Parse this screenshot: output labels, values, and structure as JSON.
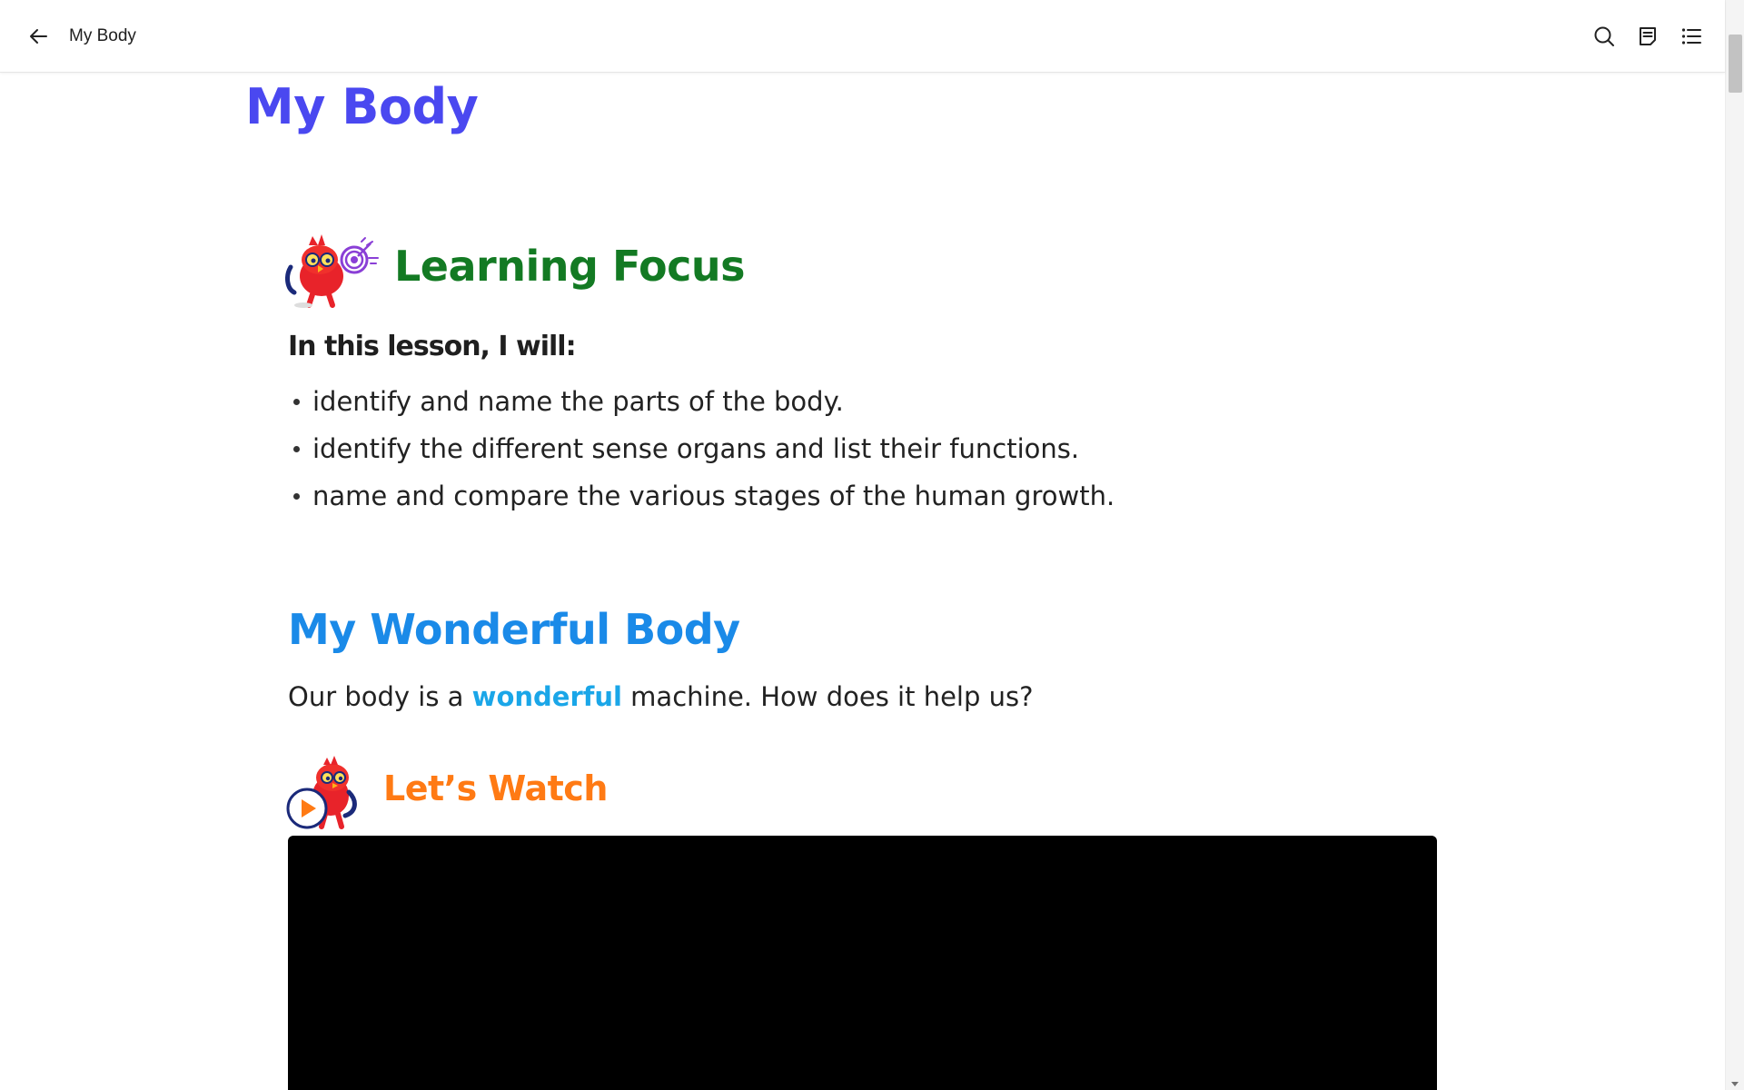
{
  "topbar": {
    "title": "My Body",
    "back_icon": "arrow-left-icon",
    "tools": [
      "search-icon",
      "notes-icon",
      "list-icon"
    ]
  },
  "page": {
    "title": "My Body"
  },
  "learning_focus": {
    "heading": "Learning Focus",
    "intro": "In this lesson, I will:",
    "items": [
      "identify and name the parts of the body.",
      "identify the different sense organs and list their functions.",
      "name and compare the various stages of the human growth."
    ]
  },
  "wonderful_body": {
    "heading": "My Wonderful Body",
    "para_before": "Our body is a ",
    "para_highlight": "wonderful",
    "para_after": " machine. How does it help us?"
  },
  "lets_watch": {
    "heading": "Let’s Watch"
  },
  "colors": {
    "page_title": "#4a48f0",
    "learning_focus": "#137a23",
    "section_heading": "#1a8ae8",
    "highlight": "#1aa6e8",
    "watch_heading": "#ff7a14"
  }
}
